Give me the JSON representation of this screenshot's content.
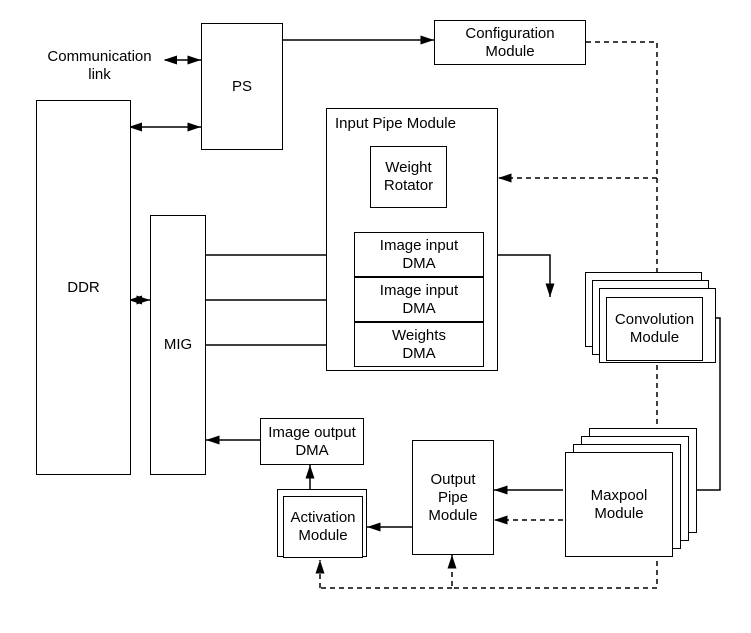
{
  "nodes": {
    "comm_link": "Communication\nlink",
    "ps": "PS",
    "ddr": "DDR",
    "mig": "MIG",
    "config": "Configuration\nModule",
    "input_pipe": "Input Pipe Module",
    "weight_rot": "Weight\nRotator",
    "img_dma1": "Image input\nDMA",
    "img_dma2": "Image input\nDMA",
    "weights_dma": "Weights\nDMA",
    "convolution": "Convolution\nModule",
    "maxpool": "Maxpool\nModule",
    "output_pipe": "Output\nPipe\nModule",
    "activation": "Activation\nModule",
    "img_out_dma": "Image output\nDMA"
  }
}
